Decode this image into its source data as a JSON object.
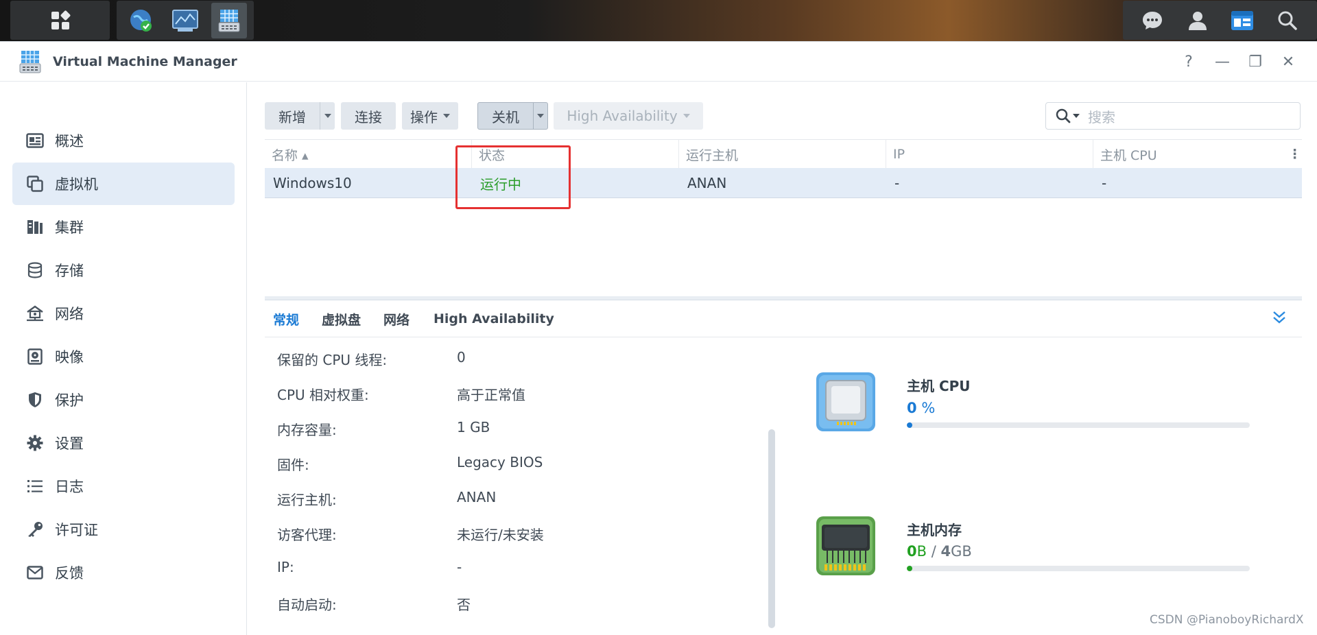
{
  "window": {
    "title": "Virtual Machine Manager",
    "controls": [
      "?",
      "—",
      "❐",
      "✕"
    ]
  },
  "sidebar": {
    "items": [
      {
        "label": "概述",
        "icon": "overview-icon"
      },
      {
        "label": "虚拟机",
        "icon": "virtual-machine-icon",
        "selected": true
      },
      {
        "label": "集群",
        "icon": "cluster-icon"
      },
      {
        "label": "存储",
        "icon": "storage-icon"
      },
      {
        "label": "网络",
        "icon": "network-icon"
      },
      {
        "label": "映像",
        "icon": "image-icon"
      },
      {
        "label": "保护",
        "icon": "shield-icon"
      },
      {
        "label": "设置",
        "icon": "gear-icon"
      },
      {
        "label": "日志",
        "icon": "log-list-icon"
      },
      {
        "label": "许可证",
        "icon": "key-icon"
      },
      {
        "label": "反馈",
        "icon": "mail-icon"
      }
    ]
  },
  "toolbar": {
    "add_label": "新增",
    "connect_label": "连接",
    "action_label": "操作",
    "shutdown_label": "关机",
    "ha_label": "High Availability"
  },
  "search": {
    "placeholder": "搜索"
  },
  "grid": {
    "columns": [
      "名称 ▴",
      "状态",
      "运行主机",
      "IP",
      "主机 CPU"
    ],
    "rows": [
      {
        "name": "Windows10",
        "status": "运行中",
        "host": "ANAN",
        "ip": "-",
        "cpu": "-"
      }
    ]
  },
  "detail_tabs": [
    "常规",
    "虚拟盘",
    "网络",
    "High Availability"
  ],
  "properties": [
    {
      "label": "保留的 CPU 线程:",
      "value": "0"
    },
    {
      "label": "CPU 相对权重:",
      "value": "高于正常值"
    },
    {
      "label": "内存容量:",
      "value": "1 GB"
    },
    {
      "label": "固件:",
      "value": "Legacy BIOS"
    },
    {
      "label": "运行主机:",
      "value": "ANAN"
    },
    {
      "label": "访客代理:",
      "value": "未运行/未安装"
    },
    {
      "label": "IP:",
      "value": "-"
    },
    {
      "label": "自动启动:",
      "value": "否"
    }
  ],
  "resources": {
    "cpu": {
      "title": "主机 CPU",
      "value": "0",
      "unit": "%",
      "fraction": 0.0,
      "color": "#1a7ad4"
    },
    "memory": {
      "title": "主机内存",
      "used": "0",
      "used_unit": "B",
      "sep": "/",
      "total": "4",
      "total_unit": "GB",
      "fraction": 0.0,
      "color": "#22a122"
    }
  },
  "watermark": "CSDN @PianoboyRichardX",
  "colors": {
    "accent": "#1a7ad4",
    "running": "#2a9d2a",
    "highlight": "#e53131"
  }
}
